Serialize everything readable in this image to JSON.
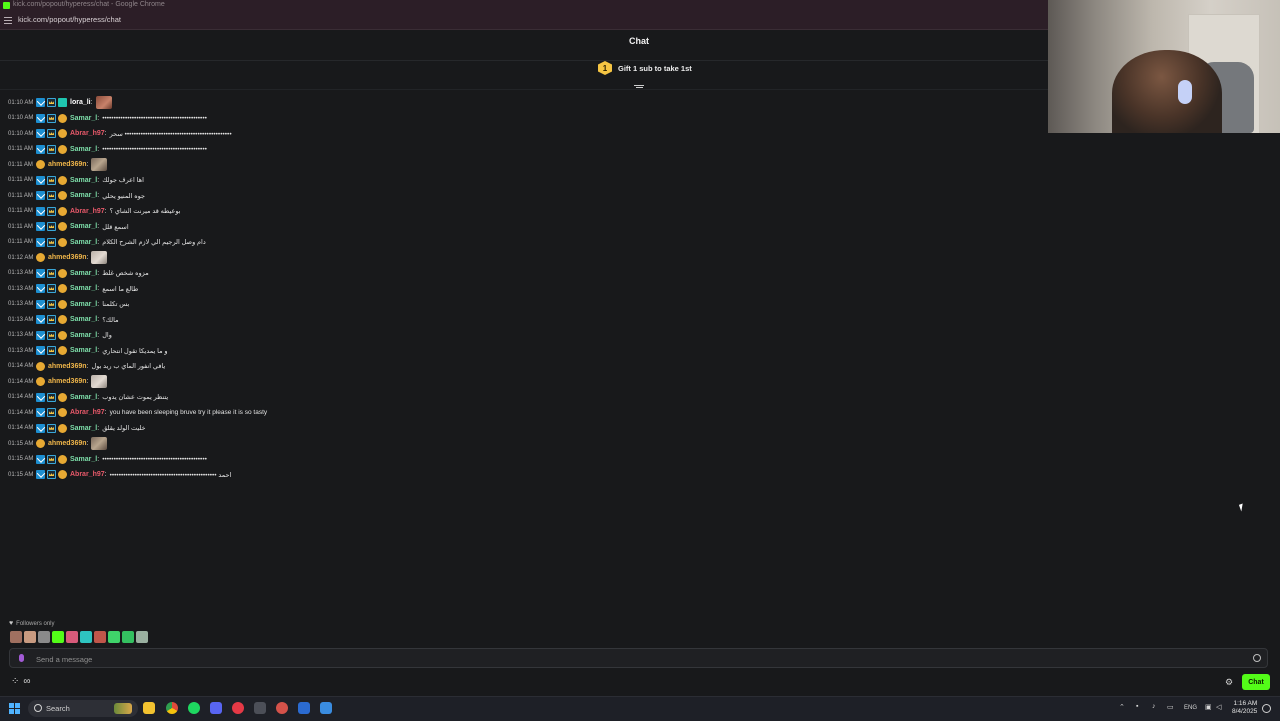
{
  "browser": {
    "window_title": "kick.com/popout/hyperess/chat - Google Chrome",
    "url": "kick.com/popout/hyperess/chat"
  },
  "chat": {
    "title": "Chat",
    "gift_prompt": "Gift 1 sub to take 1st",
    "gift_rank": "1",
    "followers_only": "Followers only",
    "input_placeholder": "Send a message",
    "chat_button": "Chat",
    "infinity_label": "∞"
  },
  "messages": [
    {
      "time": "01:10 AM",
      "user": "lora_li",
      "color": "#ffffff",
      "badges": [
        "vip",
        "crown",
        "teal"
      ],
      "text": "",
      "emote": "a"
    },
    {
      "time": "01:10 AM",
      "user": "Samar_l",
      "color": "#7cdca8",
      "badges": [
        "vip",
        "crown",
        "gift"
      ],
      "text": "••••••••••••••••••••••••••••••••••••••••••••••"
    },
    {
      "time": "01:10 AM",
      "user": "Abrar_h97",
      "color": "#e8596a",
      "badges": [
        "vip",
        "crown",
        "gift"
      ],
      "text": "سحر •••••••••••••••••••••••••••••••••••••••••••••••"
    },
    {
      "time": "01:11 AM",
      "user": "Samar_l",
      "color": "#7cdca8",
      "badges": [
        "vip",
        "crown",
        "gift"
      ],
      "text": "••••••••••••••••••••••••••••••••••••••••••••••"
    },
    {
      "time": "01:11 AM",
      "user": "ahmed369n",
      "color": "#f0b64a",
      "badges": [
        "gift"
      ],
      "text": "",
      "emote": "b"
    },
    {
      "time": "01:11 AM",
      "user": "Samar_l",
      "color": "#7cdca8",
      "badges": [
        "vip",
        "crown",
        "gift"
      ],
      "text": "اها اعرف جولك"
    },
    {
      "time": "01:11 AM",
      "user": "Samar_l",
      "color": "#7cdca8",
      "badges": [
        "vip",
        "crown",
        "gift"
      ],
      "text": "جوه المنيو يحلي"
    },
    {
      "time": "01:11 AM",
      "user": "Abrar_h97",
      "color": "#e8596a",
      "badges": [
        "vip",
        "crown",
        "gift"
      ],
      "text": "بوعيطه قد ميرنت الشاي ؟"
    },
    {
      "time": "01:11 AM",
      "user": "Samar_l",
      "color": "#7cdca8",
      "badges": [
        "vip",
        "crown",
        "gift"
      ],
      "text": "اسمع قلل"
    },
    {
      "time": "01:11 AM",
      "user": "Samar_l",
      "color": "#7cdca8",
      "badges": [
        "vip",
        "crown",
        "gift"
      ],
      "text": "دام وصل الرجيم الي لازم الشرح الكلام"
    },
    {
      "time": "01:12 AM",
      "user": "ahmed369n",
      "color": "#f0b64a",
      "badges": [
        "gift"
      ],
      "text": "",
      "emote": "c"
    },
    {
      "time": "01:13 AM",
      "user": "Samar_l",
      "color": "#7cdca8",
      "badges": [
        "vip",
        "crown",
        "gift"
      ],
      "text": "مزوه شخص غلط"
    },
    {
      "time": "01:13 AM",
      "user": "Samar_l",
      "color": "#7cdca8",
      "badges": [
        "vip",
        "crown",
        "gift"
      ],
      "text": "طالع ما اسمع"
    },
    {
      "time": "01:13 AM",
      "user": "Samar_l",
      "color": "#7cdca8",
      "badges": [
        "vip",
        "crown",
        "gift"
      ],
      "text": "بس تكلمنا"
    },
    {
      "time": "01:13 AM",
      "user": "Samar_l",
      "color": "#7cdca8",
      "badges": [
        "vip",
        "crown",
        "gift"
      ],
      "text": "مالك؟"
    },
    {
      "time": "01:13 AM",
      "user": "Samar_l",
      "color": "#7cdca8",
      "badges": [
        "vip",
        "crown",
        "gift"
      ],
      "text": "وال"
    },
    {
      "time": "01:13 AM",
      "user": "Samar_l",
      "color": "#7cdca8",
      "badges": [
        "vip",
        "crown",
        "gift"
      ],
      "text": "و ما يمديكا تقول انتحاري"
    },
    {
      "time": "01:14 AM",
      "user": "ahmed369n",
      "color": "#f0b64a",
      "badges": [
        "gift"
      ],
      "text": "يافي انفور الماي ب ريد بول"
    },
    {
      "time": "01:14 AM",
      "user": "ahmed369n",
      "color": "#f0b64a",
      "badges": [
        "gift"
      ],
      "text": "",
      "emote": "c"
    },
    {
      "time": "01:14 AM",
      "user": "Samar_l",
      "color": "#7cdca8",
      "badges": [
        "vip",
        "crown",
        "gift"
      ],
      "text": "يتنظر يموت عشان يدوب"
    },
    {
      "time": "01:14 AM",
      "user": "Abrar_h97",
      "color": "#e8596a",
      "badges": [
        "vip",
        "crown",
        "gift"
      ],
      "text": "you have been sleeping bruve try it please it is so tasty"
    },
    {
      "time": "01:14 AM",
      "user": "Samar_l",
      "color": "#7cdca8",
      "badges": [
        "vip",
        "crown",
        "gift"
      ],
      "text": "خليت الولد يقلق"
    },
    {
      "time": "01:15 AM",
      "user": "ahmed369n",
      "color": "#f0b64a",
      "badges": [
        "gift"
      ],
      "text": "",
      "emote": "b"
    },
    {
      "time": "01:15 AM",
      "user": "Samar_l",
      "color": "#7cdca8",
      "badges": [
        "vip",
        "crown",
        "gift"
      ],
      "text": "••••••••••••••••••••••••••••••••••••••••••••••"
    },
    {
      "time": "01:15 AM",
      "user": "Abrar_h97",
      "color": "#e8596a",
      "badges": [
        "vip",
        "crown",
        "gift"
      ],
      "text": "••••••••••••••••••••••••••••••••••••••••••••••• احمد"
    }
  ],
  "taskbar": {
    "search_label": "Search",
    "language": "ENG",
    "time": "1:16 AM",
    "date": "8/4/2025"
  },
  "colors": {
    "accent": "#53fc18",
    "background": "#18191b"
  }
}
